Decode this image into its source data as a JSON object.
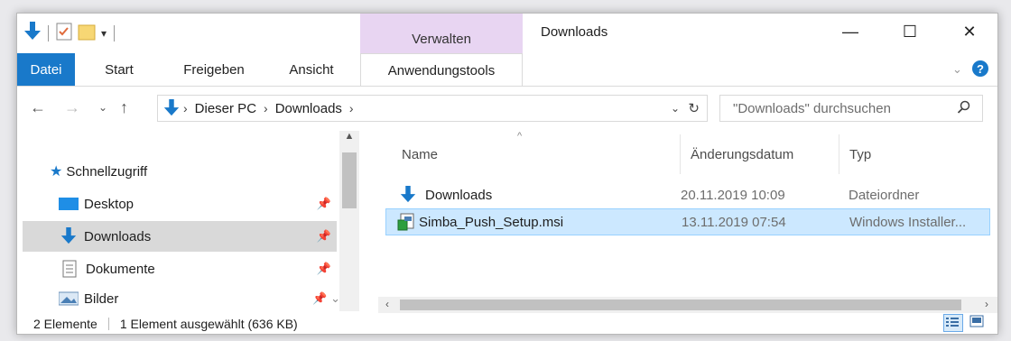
{
  "window": {
    "title": "Downloads",
    "context_tab": "Verwalten",
    "controls": {
      "minimize": "—",
      "maximize": "☐",
      "close": "✕"
    }
  },
  "ribbon": {
    "tabs": [
      "Datei",
      "Start",
      "Freigeben",
      "Ansicht",
      "Anwendungstools"
    ],
    "active_tab": "Datei",
    "accent": "#1979ca"
  },
  "address": {
    "path": [
      "Dieser PC",
      "Downloads"
    ],
    "search_placeholder": "\"Downloads\" durchsuchen"
  },
  "sidebar": {
    "items": [
      {
        "label": "Schnellzugriff",
        "icon": "star-icon"
      },
      {
        "label": "Desktop",
        "icon": "desktop-icon"
      },
      {
        "label": "Downloads",
        "icon": "download-arrow-icon",
        "selected": true
      },
      {
        "label": "Dokumente",
        "icon": "document-icon"
      },
      {
        "label": "Bilder",
        "icon": "pictures-icon"
      }
    ]
  },
  "columns": {
    "name": "Name",
    "date": "Änderungsdatum",
    "type": "Typ"
  },
  "files": [
    {
      "name": "Downloads",
      "date": "20.11.2019 10:09",
      "type": "Dateiordner",
      "icon": "download-arrow-icon"
    },
    {
      "name": "Simba_Push_Setup.msi",
      "date": "13.11.2019 07:54",
      "type": "Windows Installer...",
      "icon": "installer-icon",
      "selected": true
    }
  ],
  "status": {
    "count": "2 Elemente",
    "selection": "1 Element ausgewählt (636 KB)"
  }
}
